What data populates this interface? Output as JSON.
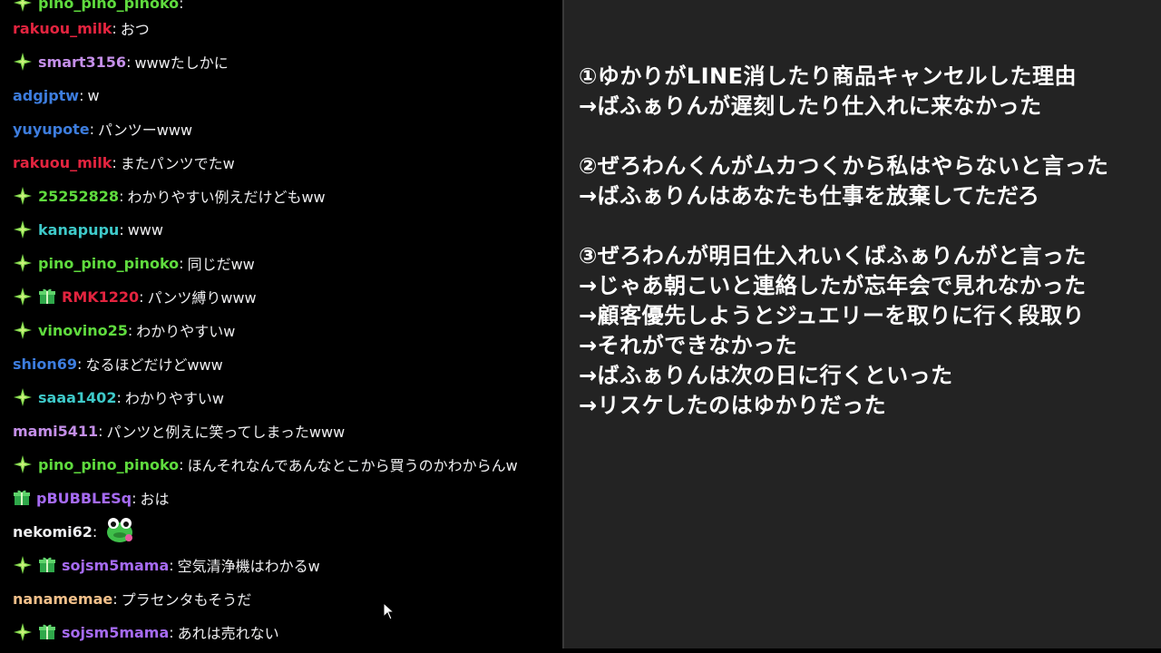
{
  "chat": {
    "messages": [
      {
        "user": "pino_pino_pinoko",
        "color": "#5fdb3e",
        "badges": [
          "prime"
        ],
        "text": ""
      },
      {
        "user": "rakuou_milk",
        "color": "#e3243f",
        "badges": [],
        "text": "おつ"
      },
      {
        "user": "smart3156",
        "color": "#c48fe8",
        "badges": [
          "prime"
        ],
        "text": "wwwたしかに"
      },
      {
        "user": "adgjptw",
        "color": "#3d7dde",
        "badges": [],
        "text": "w"
      },
      {
        "user": "yuyupote",
        "color": "#3d7dde",
        "badges": [],
        "text": "パンツーwww"
      },
      {
        "user": "rakuou_milk",
        "color": "#e3243f",
        "badges": [],
        "text": "またパンツでたw"
      },
      {
        "user": "25252828",
        "color": "#5fdb3e",
        "badges": [
          "prime"
        ],
        "text": "わかりやすい例えだけどもww"
      },
      {
        "user": "kanapupu",
        "color": "#3ec9c9",
        "badges": [
          "prime"
        ],
        "text": "www"
      },
      {
        "user": "pino_pino_pinoko",
        "color": "#5fdb3e",
        "badges": [
          "prime"
        ],
        "text": "同じだww"
      },
      {
        "user": "RMK1220",
        "color": "#e3243f",
        "badges": [
          "prime",
          "gift"
        ],
        "text": "パンツ縛りwww"
      },
      {
        "user": "vinovino25",
        "color": "#5fdb3e",
        "badges": [
          "prime"
        ],
        "text": "わかりやすいw"
      },
      {
        "user": "shion69",
        "color": "#3d7dde",
        "badges": [],
        "text": "なるほどだけどwww"
      },
      {
        "user": "saaa1402",
        "color": "#3ec9c9",
        "badges": [
          "prime"
        ],
        "text": "わかりやすいw"
      },
      {
        "user": "mami5411",
        "color": "#c48fe8",
        "badges": [],
        "text": "パンツと例えに笑ってしまったwww"
      },
      {
        "user": "pino_pino_pinoko",
        "color": "#5fdb3e",
        "badges": [
          "prime"
        ],
        "text": "ほんそれなんであんなとこから買うのかわからんw"
      },
      {
        "user": "pBUBBLESq",
        "color": "#a66bf2",
        "badges": [
          "gift"
        ],
        "text": "おは"
      },
      {
        "user": "nekomi62",
        "color": "#efeff1",
        "badges": [],
        "text": "",
        "emote": "frog-emote"
      },
      {
        "user": "sojsm5mama",
        "color": "#a66bf2",
        "badges": [
          "prime",
          "gift"
        ],
        "text": "空気清浄機はわかるw"
      },
      {
        "user": "nanamemae",
        "color": "#f2c08a",
        "badges": [],
        "text": "プラセンタもそうだ"
      },
      {
        "user": "sojsm5mama",
        "color": "#a66bf2",
        "badges": [
          "prime",
          "gift"
        ],
        "text": "あれは売れない"
      }
    ]
  },
  "notes": {
    "lines": [
      "①ゆかりがLINE消したり商品キャンセルした理由",
      "→ばふぁりんが遅刻したり仕入れに来なかった",
      "",
      "②ぜろわんくんがムカつくから私はやらないと言った",
      "→ばふぁりんはあなたも仕事を放棄してただろ",
      "",
      "③ぜろわんが明日仕入れいくばふぁりんがと言った",
      "→じゃあ朝こいと連絡したが忘年会で見れなかった",
      "→顧客優先しようとジュエリーを取りに行く段取り",
      "→それができなかった",
      "→ばふぁりんは次の日に行くといった",
      "→リスケしたのはゆかりだった"
    ]
  }
}
